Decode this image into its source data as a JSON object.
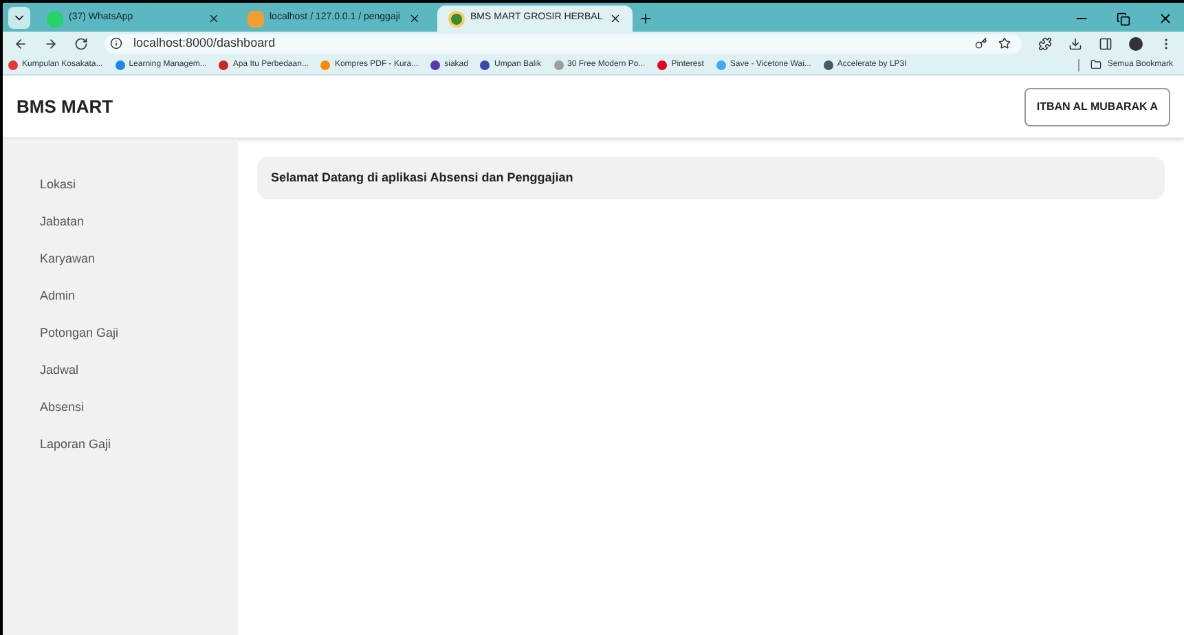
{
  "browser": {
    "tabs": [
      {
        "title": "(37) WhatsApp",
        "kind": "whatsapp",
        "selected": false
      },
      {
        "title": "localhost / 127.0.0.1 / penggaji",
        "kind": "db",
        "selected": false
      },
      {
        "title": "BMS MART GROSIR HERBAL",
        "kind": "site",
        "selected": true
      }
    ],
    "url": "localhost:8000/dashboard",
    "bookmarks": [
      {
        "title": "Kumpulan Kosakata...",
        "color": "#e53935"
      },
      {
        "title": "Learning Managem...",
        "color": "#1e88e5"
      },
      {
        "title": "Apa Itu Perbedaan...",
        "color": "#c62828"
      },
      {
        "title": "Kompres PDF - Kura...",
        "color": "#fb8c00"
      },
      {
        "title": "siakad",
        "color": "#5e35b1"
      },
      {
        "title": "Umpan Balik",
        "color": "#3949ab"
      },
      {
        "title": "30 Free Modern Po...",
        "color": "#9e9e9e"
      },
      {
        "title": "Pinterest",
        "color": "#e60023"
      },
      {
        "title": "Save - Vicetone Wai...",
        "color": "#42a5f5"
      },
      {
        "title": "Accelerate by LP3I",
        "color": "#455a64"
      }
    ],
    "all_bookmarks": "Semua Bookmark"
  },
  "app": {
    "brand": "BMS MART",
    "user_button": "ITBAN AL MUBARAK A",
    "sidebar": {
      "items": [
        "Lokasi",
        "Jabatan",
        "Karyawan",
        "Admin",
        "Potongan Gaji",
        "Jadwal",
        "Absensi",
        "Laporan Gaji"
      ]
    },
    "welcome": "Selamat Datang di aplikasi Absensi dan Penggajian"
  }
}
